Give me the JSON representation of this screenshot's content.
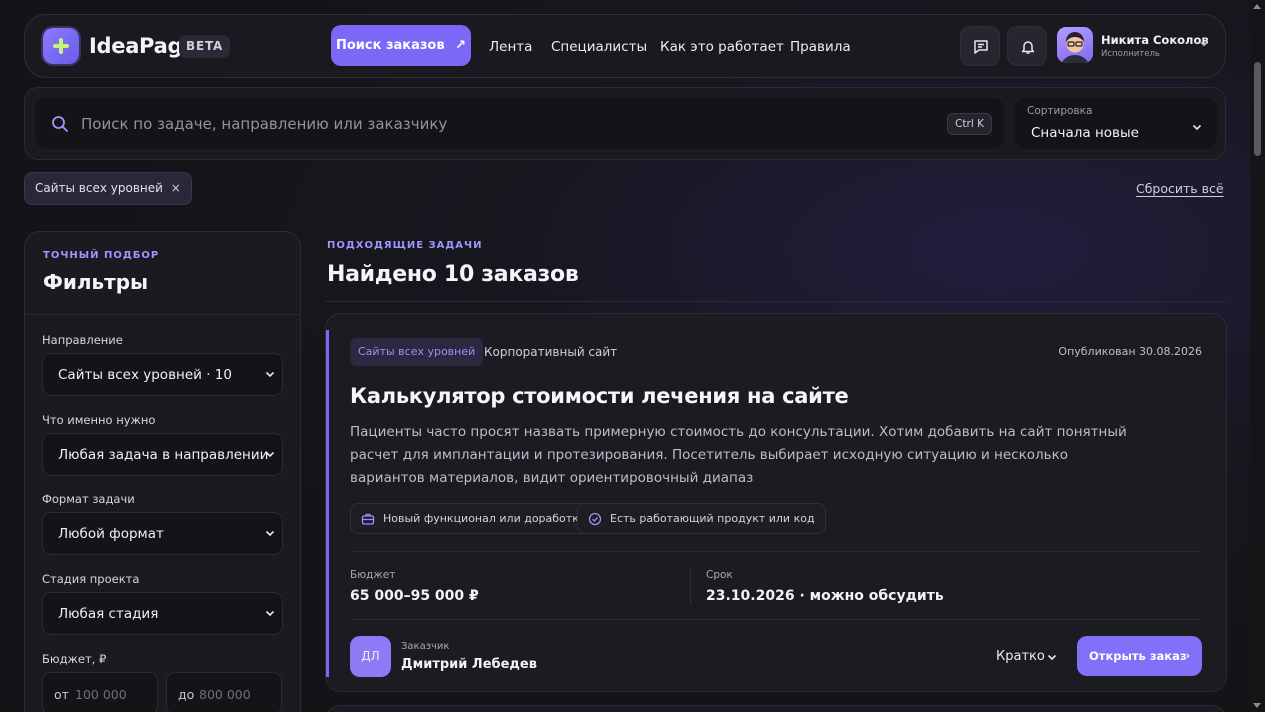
{
  "header": {
    "logo_text": "IdeaPage",
    "beta": "BETA",
    "primary_nav": "Поиск заказов",
    "nav_links": [
      "Лента",
      "Специалисты",
      "Как это работает",
      "Правила"
    ],
    "user": {
      "name": "Никита Соколов",
      "role": "Исполнитель"
    },
    "icons": [
      "chat-icon",
      "bell-icon",
      "chevron-down-icon"
    ]
  },
  "search": {
    "placeholder": "Поиск по задаче, направлению или заказчику",
    "shortcut": "Ctrl K",
    "sort_label": "Сортировка",
    "sort_value": "Сначала новые"
  },
  "active_filters": {
    "chips": [
      "Сайты всех уровней"
    ],
    "reset_label": "Сбросить всё"
  },
  "filters": {
    "eyebrow": "ТОЧНЫЙ ПОДБОР",
    "title": "Фильтры",
    "fields": [
      {
        "label": "Направление",
        "value": "Сайты всех уровней · 10"
      },
      {
        "label": "Что именно нужно",
        "value": "Любая задача в направлении"
      },
      {
        "label": "Формат задачи",
        "value": "Любой формат"
      },
      {
        "label": "Стадия проекта",
        "value": "Любая стадия"
      }
    ],
    "budget": {
      "label": "Бюджет, ₽",
      "from_prefix": "от",
      "from_placeholder": "100 000",
      "to_prefix": "до",
      "to_placeholder": "800 000"
    }
  },
  "results": {
    "eyebrow": "ПОДХОДЯЩИЕ ЗАДАЧИ",
    "title": "Найдено 10 заказов"
  },
  "card": {
    "tag": "Сайты всех уровней",
    "subcategory": "Корпоративный сайт",
    "published": "Опубликован 30.08.2026",
    "title": "Калькулятор стоимости лечения на сайте",
    "description": "Пациенты часто просят назвать примерную стоимость до консультации. Хотим добавить на сайт понятный расчет для имплантации и протезирования. Посетитель выбирает исходную ситуацию и несколько вариантов материалов, видит ориентировочный диапаз",
    "pills": [
      "Новый функционал или доработка",
      "Есть работающий продукт или код"
    ],
    "budget_label": "Бюджет",
    "budget_value": "65 000–95 000 ₽",
    "deadline_label": "Срок",
    "deadline_value": "23.10.2026 · можно обсудить",
    "customer_label": "Заказчик",
    "customer_initials": "ДЛ",
    "customer_name": "Дмитрий Лебедев",
    "brief_label": "Кратко",
    "open_label": "Открыть заказ",
    "open_arrow": "›"
  },
  "colors": {
    "accent": "#7b68f6",
    "background": "#17171f",
    "lime": "#c6f47a"
  }
}
